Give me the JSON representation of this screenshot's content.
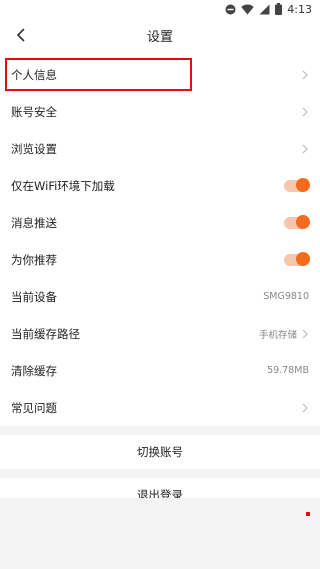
{
  "status": {
    "time": "4:13"
  },
  "header": {
    "title": "设置"
  },
  "settings": {
    "personal_info": "个人信息",
    "account_security": "账号安全",
    "browse_settings": "浏览设置",
    "wifi_only": "仅在WiFi环境下加载",
    "push": "消息推送",
    "recommend": "为你推荐",
    "device_label": "当前设备",
    "device_value": "SMG9810",
    "cache_path_label": "当前缓存路径",
    "cache_path_value": "手机存储",
    "clear_cache_label": "清除缓存",
    "clear_cache_value": "59.78MB",
    "faq": "常见问题"
  },
  "toggles": {
    "wifi_only": true,
    "push": true,
    "recommend": true
  },
  "actions": {
    "switch_account": "切换账号",
    "logout": "退出登录"
  },
  "colors": {
    "accent": "#f36b1c",
    "highlight": "#e01010"
  }
}
